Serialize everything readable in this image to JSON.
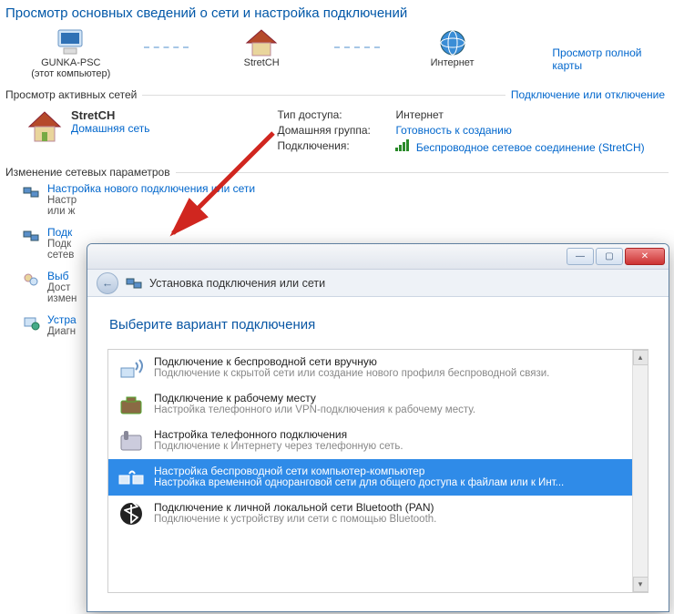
{
  "heading": "Просмотр основных сведений о сети и настройка подключений",
  "map": {
    "node1": {
      "label": "GUNKA-PSC",
      "sub": "(этот компьютер)"
    },
    "node2": {
      "label": "StretCH"
    },
    "node3": {
      "label": "Интернет"
    },
    "full_map_link": "Просмотр полной карты"
  },
  "section_active": {
    "label": "Просмотр активных сетей",
    "action": "Подключение или отключение"
  },
  "active_net": {
    "name": "StretCH",
    "type_link": "Домашняя сеть",
    "props": {
      "access_key": "Тип доступа:",
      "access_val": "Интернет",
      "homegroup_key": "Домашняя группа:",
      "homegroup_val": "Готовность к созданию",
      "conn_key": "Подключения:",
      "conn_val": "Беспроводное сетевое соединение (StretCH)"
    }
  },
  "section_change": {
    "label": "Изменение сетевых параметров"
  },
  "change_items": [
    {
      "title": "Настройка нового подключения или сети",
      "desc_prefix": "Настр",
      "desc_suffix": "или ж"
    },
    {
      "title_prefix": "Подк",
      "desc_prefix": "Подк",
      "desc2_prefix": "сетев"
    },
    {
      "title_prefix": "Выб",
      "desc_prefix": "Дост",
      "desc2_prefix": "измен"
    },
    {
      "title_prefix": "Устра",
      "desc_prefix": "Диагн"
    }
  ],
  "wizard": {
    "titlebar": {
      "min_tip": "Свернуть",
      "max_tip": "Развернуть",
      "close_tip": "Закрыть"
    },
    "subbar_title": "Установка подключения или сети",
    "heading": "Выберите вариант подключения",
    "options": [
      {
        "title": "Подключение к беспроводной сети вручную",
        "desc": "Подключение к скрытой сети или создание нового профиля беспроводной связи."
      },
      {
        "title": "Подключение к рабочему месту",
        "desc": "Настройка телефонного или VPN-подключения к рабочему месту."
      },
      {
        "title": "Настройка телефонного подключения",
        "desc": "Подключение к Интернету через телефонную сеть."
      },
      {
        "title": "Настройка беспроводной сети компьютер-компьютер",
        "desc": "Настройка временной одноранговой сети для общего доступа к файлам или к Инт..."
      },
      {
        "title": "Подключение к личной локальной сети Bluetooth (PAN)",
        "desc": "Подключение к устройству или сети с помощью Bluetooth."
      }
    ]
  }
}
